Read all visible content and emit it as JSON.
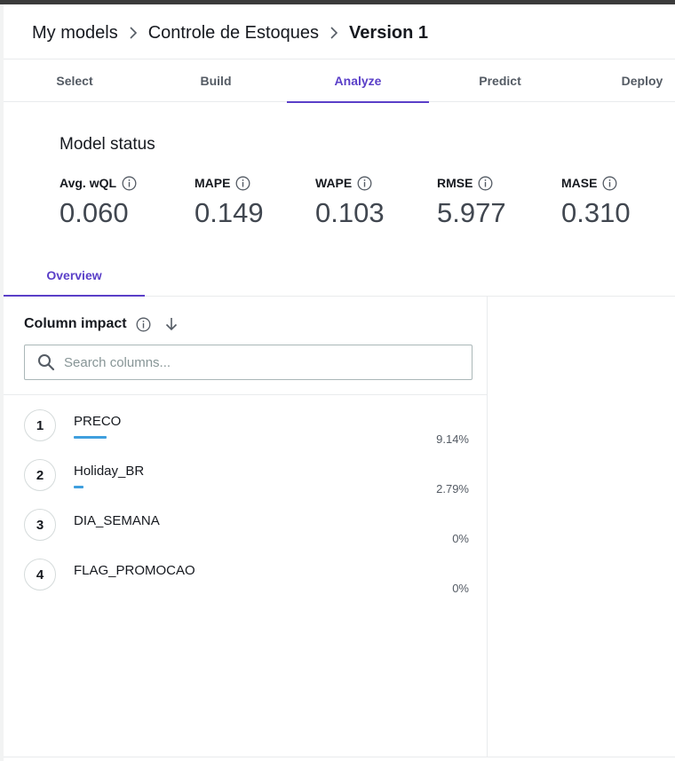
{
  "breadcrumb": {
    "items": [
      "My models",
      "Controle de Estoques"
    ],
    "current": "Version 1"
  },
  "tabs": [
    "Select",
    "Build",
    "Analyze",
    "Predict",
    "Deploy"
  ],
  "active_tab": "Analyze",
  "model_status": {
    "title": "Model status",
    "metrics": [
      {
        "label": "Avg. wQL",
        "value": "0.060"
      },
      {
        "label": "MAPE",
        "value": "0.149"
      },
      {
        "label": "WAPE",
        "value": "0.103"
      },
      {
        "label": "RMSE",
        "value": "5.977"
      },
      {
        "label": "MASE",
        "value": "0.310"
      }
    ]
  },
  "subtabs": [
    "Overview"
  ],
  "column_impact": {
    "title": "Column impact",
    "search_placeholder": "Search columns...",
    "rows": [
      {
        "rank": "1",
        "name": "PRECO",
        "percent_label": "9.14%",
        "impact": 9.14
      },
      {
        "rank": "2",
        "name": "Holiday_BR",
        "percent_label": "2.79%",
        "impact": 2.79
      },
      {
        "rank": "3",
        "name": "DIA_SEMANA",
        "percent_label": "0%",
        "impact": 0
      },
      {
        "rank": "4",
        "name": "FLAG_PROMOCAO",
        "percent_label": "0%",
        "impact": 0
      }
    ]
  },
  "colors": {
    "accent": "#5a3fc8",
    "bar": "#3f9fde",
    "topbar": "#3b3b3b"
  },
  "icons": {
    "breadcrumb_separator": "chevron-right-icon",
    "info": "info-icon",
    "sort": "arrow-down-icon",
    "search": "search-icon"
  }
}
